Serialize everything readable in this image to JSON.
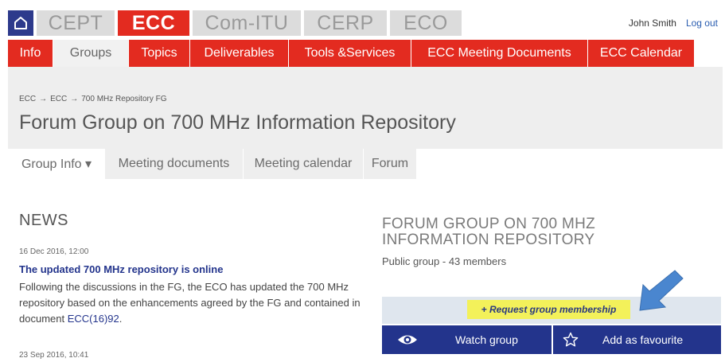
{
  "top_tabs": [
    "CEPT",
    "ECC",
    "Com-ITU",
    "CERP",
    "ECO"
  ],
  "user": {
    "name": "John Smith",
    "logout": "Log out"
  },
  "nav": [
    "Info",
    "Groups",
    "Topics",
    "Deliverables",
    "Tools &Services",
    "ECC Meeting Documents",
    "ECC Calendar"
  ],
  "breadcrumb": [
    "ECC",
    "ECC",
    "700 MHz Repository FG"
  ],
  "breadcrumb_sep": "→",
  "page_title": "Forum Group on 700 MHz Information Repository",
  "subnav": [
    "Group Info ▾",
    "Meeting documents",
    "Meeting calendar",
    "Forum"
  ],
  "news": {
    "heading": "NEWS",
    "items": [
      {
        "date": "16 Dec 2016, 12:00",
        "title": "The updated 700 MHz repository is online",
        "body": "Following the discussions in the FG, the ECO has updated the 700 MHz repository based on the enhancements agreed by the FG and contained in document ",
        "link": "ECC(16)92",
        "end": "."
      },
      {
        "date": "23 Sep 2016, 10:41"
      }
    ]
  },
  "group_panel": {
    "title": "FORUM GROUP ON 700 MHZ INFORMATION REPOSITORY",
    "meta": "Public group  -  43  members",
    "request_button": "+ Request group membership",
    "watch_button": "Watch group",
    "favourite_button": "Add as favourite"
  },
  "colors": {
    "red": "#e32b20",
    "navy": "#23348c",
    "yellow": "#f3f15a",
    "arrow": "#4a86cf"
  }
}
